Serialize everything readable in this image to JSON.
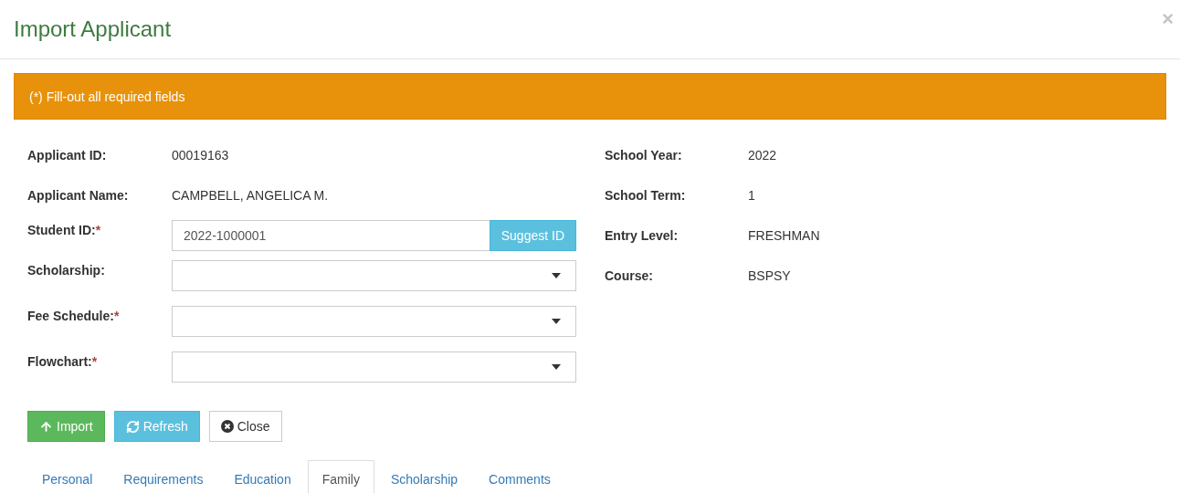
{
  "title": "Import Applicant",
  "close_glyph": "×",
  "alert": "(*) Fill-out all required fields",
  "left_fields": [
    {
      "kind": "text",
      "label": "Applicant ID:",
      "required": false,
      "value": "00019163"
    },
    {
      "kind": "text",
      "label": "Applicant Name:",
      "required": false,
      "value": "CAMPBELL, ANGELICA M."
    },
    {
      "kind": "input",
      "label": "Student ID:",
      "required": true,
      "value": "2022-1000001",
      "addon": "Suggest ID"
    },
    {
      "kind": "select",
      "label": "Scholarship:",
      "required": false
    },
    {
      "kind": "select",
      "label": "Fee Schedule:",
      "required": true
    },
    {
      "kind": "select",
      "label": "Flowchart:",
      "required": true
    }
  ],
  "required_mark": "*",
  "right_fields": [
    {
      "label": "School Year:",
      "value": "2022"
    },
    {
      "label": "School Term:",
      "value": "1"
    },
    {
      "label": "Entry Level:",
      "value": "FRESHMAN"
    },
    {
      "label": "Course:",
      "value": "BSPSY"
    }
  ],
  "buttons": [
    {
      "kind": "import",
      "label": "Import"
    },
    {
      "kind": "refresh",
      "label": "Refresh"
    },
    {
      "kind": "close",
      "label": "Close"
    }
  ],
  "tabs": [
    {
      "label": "Personal",
      "selected": false
    },
    {
      "label": "Requirements",
      "selected": false
    },
    {
      "label": "Education",
      "selected": false
    },
    {
      "label": "Family",
      "selected": true
    },
    {
      "label": "Scholarship",
      "selected": false
    },
    {
      "label": "Comments",
      "selected": false
    }
  ]
}
